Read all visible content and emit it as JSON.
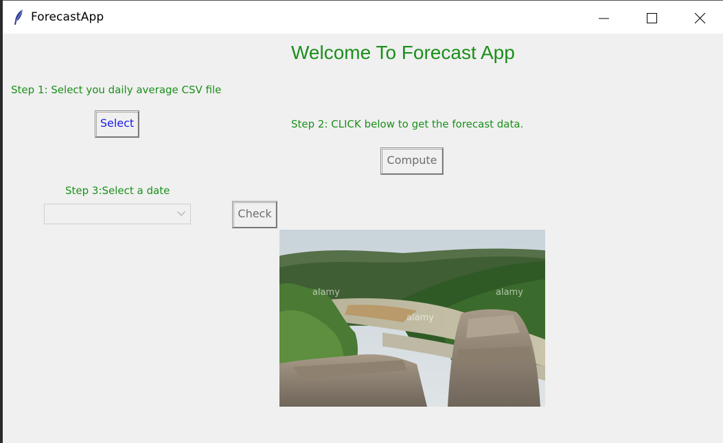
{
  "window": {
    "title": "ForecastApp",
    "app_icon": "feather-icon",
    "controls": [
      "minimize-icon",
      "maximize-icon",
      "close-icon"
    ]
  },
  "main": {
    "heading": "Welcome To Forecast App",
    "step1_label": "Step 1: Select you daily average CSV file",
    "select_button": "Select",
    "step2_label": "Step 2: CLICK below to get the forecast data.",
    "compute_button": "Compute",
    "step3_label": "Step 3:Select a date",
    "date_combo_value": "",
    "check_button": "Check",
    "image_watermark": "alamy"
  },
  "colors": {
    "accent_green": "#1a8f1a",
    "select_text": "#1a1aee",
    "disabled_text": "#6d6d6d",
    "background": "#f0f0f0"
  }
}
